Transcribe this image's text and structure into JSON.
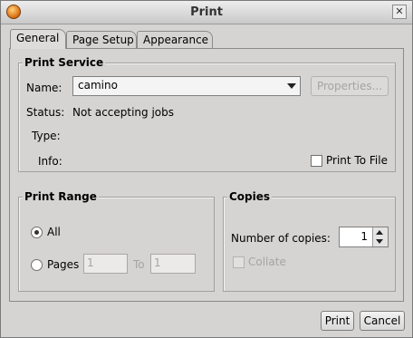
{
  "window": {
    "title": "Print"
  },
  "tabs": [
    {
      "label": "General"
    },
    {
      "label": "Page Setup"
    },
    {
      "label": "Appearance"
    }
  ],
  "print_service": {
    "heading": "Print Service",
    "name_label": "Name:",
    "name_value": "camino",
    "properties_button": "Properties...",
    "status_label": "Status:",
    "status_value": "Not accepting jobs",
    "type_label": "Type:",
    "info_label": "Info:",
    "print_to_file_label": "Print To File"
  },
  "print_range": {
    "heading": "Print Range",
    "all_label": "All",
    "pages_label": "Pages",
    "from_value": "1",
    "to_label": "To",
    "to_value": "1"
  },
  "copies": {
    "heading": "Copies",
    "number_label": "Number of copies:",
    "number_value": "1",
    "collate_label": "Collate"
  },
  "footer": {
    "print_button": "Print",
    "cancel_button": "Cancel"
  },
  "icons": [
    "app-icon",
    "close-icon",
    "dropdown-arrow-icon",
    "spinner-up-icon",
    "spinner-down-icon"
  ]
}
